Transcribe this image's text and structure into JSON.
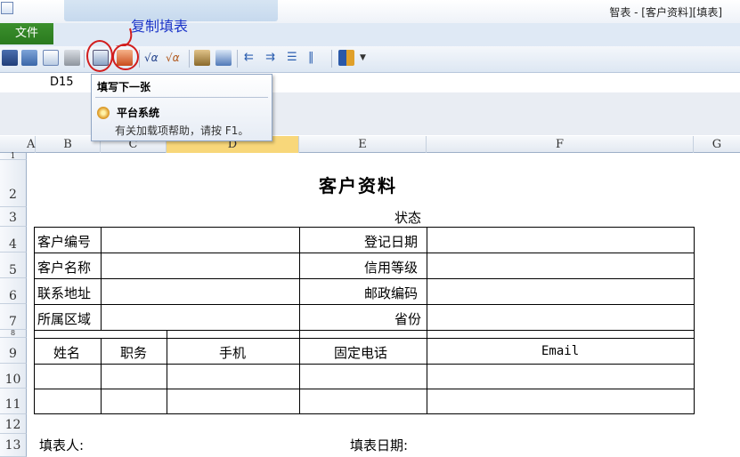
{
  "window": {
    "title": "智表 - [客户资料][填表]"
  },
  "ribbon": {
    "file_tab": "文件"
  },
  "annotation": {
    "label": "复制填表"
  },
  "name_box": {
    "value": "D15"
  },
  "tooltip": {
    "title": "填写下一张",
    "addin_name": "平台系统",
    "help_text": "有关加载项帮助，请按 F1。"
  },
  "columns": [
    "A",
    "B",
    "C",
    "D",
    "E",
    "F",
    "G"
  ],
  "selected_column": "D",
  "rows": [
    "1",
    "2",
    "3",
    "4",
    "5",
    "6",
    "7",
    "8",
    "9",
    "10",
    "11",
    "12",
    "13"
  ],
  "sheet": {
    "title": "客户资料",
    "status_label": "状态",
    "info_labels_left": [
      "客户编号",
      "客户名称",
      "联系地址",
      "所属区域"
    ],
    "info_labels_right": [
      "登记日期",
      "信用等级",
      "邮政编码",
      "省份"
    ],
    "contact_headers": [
      "姓名",
      "职务",
      "手机",
      "固定电话",
      "Email"
    ],
    "footer_left": "填表人:",
    "footer_right": "填表日期:"
  },
  "toolbar_icons": [
    "save-icon",
    "edit-icon",
    "document-icon",
    "print-icon",
    "copy-fill-icon",
    "next-fill-icon",
    "formula-icon",
    "formula-check-icon",
    "paste-icon",
    "image-icon",
    "indent-left-icon",
    "indent-right-icon",
    "align-icon",
    "columns-icon",
    "book-icon",
    "dropdown-icon"
  ]
}
